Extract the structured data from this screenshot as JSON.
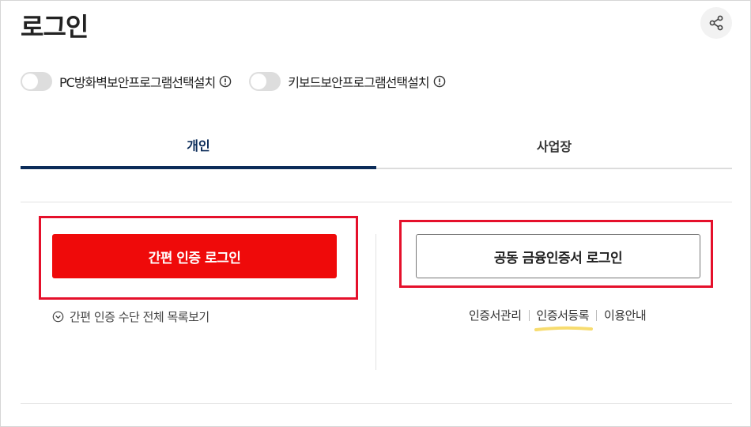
{
  "header": {
    "title": "로그인",
    "share_icon": "share-icon"
  },
  "security_toggles": [
    {
      "label": "PC방화벽보안프로그램선택설치",
      "enabled": false,
      "info_icon": "info-circle-icon"
    },
    {
      "label": "키보드보안프로그램선택설치",
      "enabled": false,
      "info_icon": "info-circle-icon"
    }
  ],
  "tabs": [
    {
      "label": "개인",
      "active": true
    },
    {
      "label": "사업장",
      "active": false
    }
  ],
  "simple_auth": {
    "button_label": "간편 인증 로그인",
    "list_link_label": "간편 인증 수단 전체 목록보기",
    "list_link_icon": "chevron-down-circle-icon"
  },
  "cert_auth": {
    "button_label": "공동 금융인증서 로그인",
    "links": [
      "인증서관리",
      "인증서등록",
      "이용안내"
    ]
  },
  "colors": {
    "primary_red": "#ef0a0a",
    "highlight_red": "#e5102b",
    "tab_navy": "#0b2c59",
    "underline_yellow": "#f7dc6f"
  }
}
